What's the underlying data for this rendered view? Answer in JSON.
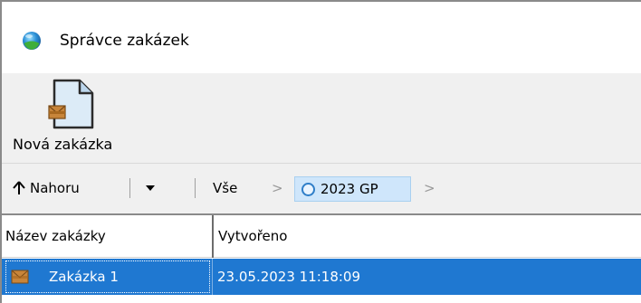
{
  "window": {
    "title": "Správce zakázek",
    "app_icon": "globe-app-icon"
  },
  "ribbon": {
    "new_order": {
      "label": "Nová zakázka",
      "icon": "new-document-icon"
    }
  },
  "navbar": {
    "up_label": "Nahoru",
    "up_icon": "arrow-up-icon",
    "dropdown_icon": "caret-down-icon",
    "breadcrumbs": [
      {
        "label": "Vše"
      },
      {
        "label": "2023 GP",
        "active": true,
        "icon": "circle-folder-icon"
      }
    ],
    "separator": ">"
  },
  "table": {
    "columns": [
      "Název zakázky",
      "Vytvořeno"
    ],
    "rows": [
      {
        "name": "Zakázka 1",
        "created": "23.05.2023 11:18:09",
        "selected": true,
        "icon": "order-envelope-icon"
      }
    ]
  },
  "colors": {
    "selection": "#1f78d1",
    "active_crumb": "#cfe6fb"
  }
}
